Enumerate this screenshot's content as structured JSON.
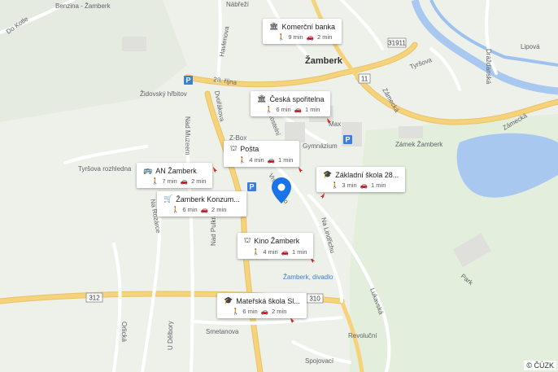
{
  "map": {
    "copyright": "© ČÚZK",
    "town_label": "Žamberk",
    "street_labels": [
      "Do Kotle",
      "Benzina - Žamberk",
      "Havlenova",
      "Nábřeží",
      "Komerční banka",
      "Nádražní",
      "Drážďanská",
      "Tyršova",
      "Lipová",
      "Zámecká",
      "28. října",
      "Žamberk",
      "Židovský hřbitov",
      "Dvořákova",
      "Nad Muzeem",
      "Z-Box",
      "Česká spořitelna",
      "Kostelní",
      "Gymnázium",
      "Zámek Žamberk",
      "Max",
      "Tyršova rozhledna",
      "Na Rozárce",
      "Na Pustině",
      "Nad Pulkrábkou",
      "Nádražní",
      "Vrchlického",
      "Na Lindřichu",
      "Lukavská",
      "Park",
      "Žamberk, divadlo",
      "Orlická",
      "Smetanova",
      "U Dělbory",
      "Revoluční",
      "Spojovací",
      "Kunčická",
      "Jungmannova"
    ],
    "road_numbers": [
      "31911",
      "11",
      "312",
      "310"
    ]
  },
  "pois": [
    {
      "name": "Komerční banka",
      "icon": "bank-icon",
      "walk": "9 min",
      "drive": "2 min"
    },
    {
      "name": "Česká spořitelna",
      "icon": "bank-icon",
      "walk": "6 min",
      "drive": "1 min"
    },
    {
      "name": "Pošta",
      "icon": "post-office-icon",
      "walk": "4 min",
      "drive": "1 min"
    },
    {
      "name": "Základní škola 28...",
      "icon": "school-icon",
      "walk": "3 min",
      "drive": "1 min"
    },
    {
      "name": "AN Žamberk",
      "icon": "bus-icon",
      "walk": "7 min",
      "drive": "2 min"
    },
    {
      "name": "Žamberk Konzum...",
      "icon": "shop-icon",
      "walk": "6 min",
      "drive": "2 min"
    },
    {
      "name": "Kino Žamberk",
      "icon": "cinema-icon",
      "walk": "4 min",
      "drive": "1 min"
    },
    {
      "name": "Mateřská škola Sl...",
      "icon": "school-icon",
      "walk": "6 min",
      "drive": "2 min"
    }
  ],
  "colors": {
    "water": "#a8c8f0",
    "road_yellow": "#f6d27a",
    "road_white": "#ffffff",
    "park": "#cfe8c0",
    "pin": "#1a73e8"
  }
}
